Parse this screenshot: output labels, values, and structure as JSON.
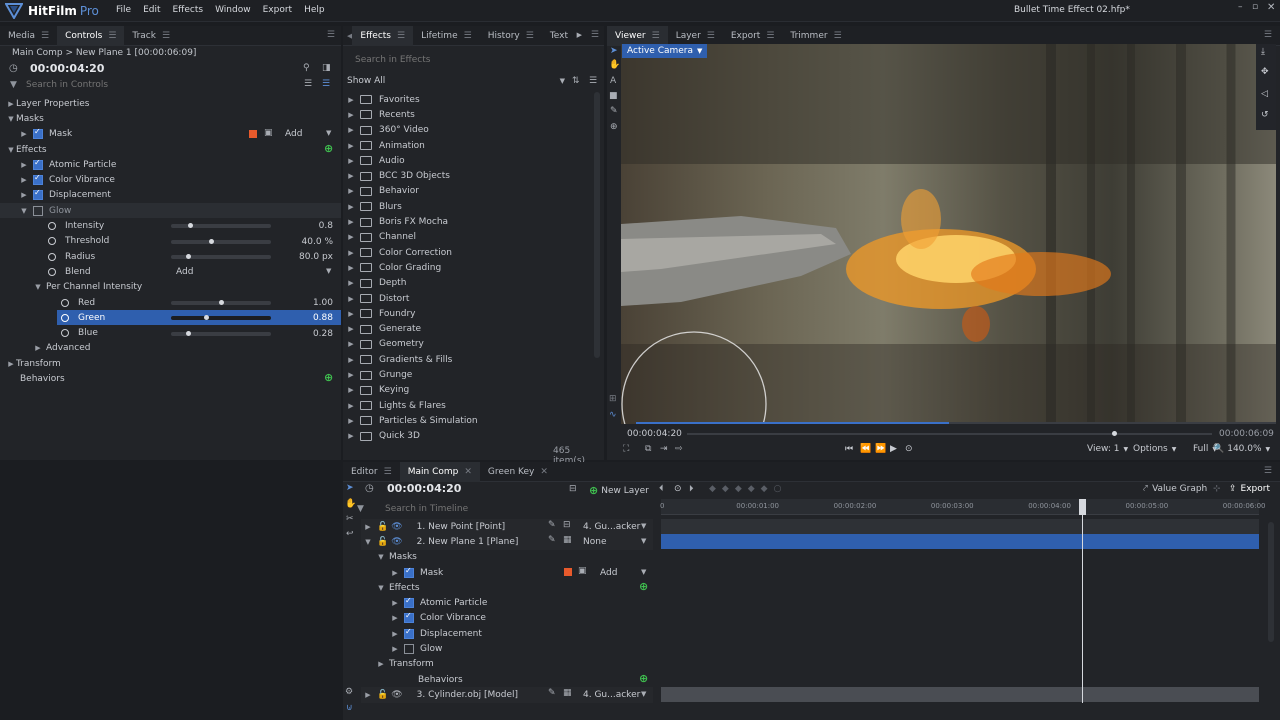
{
  "app": {
    "name": "HitFilm",
    "edition": "Pro",
    "window_title": "Bullet Time Effect 02.hfp*",
    "menu": [
      "File",
      "Edit",
      "Effects",
      "Window",
      "Export",
      "Help"
    ]
  },
  "controls": {
    "tabs": [
      "Media",
      "Controls",
      "Track"
    ],
    "breadcrumb": "Main Comp > New Plane 1 [00:00:06:09]",
    "timecode": "00:00:04:20",
    "search_placeholder": "Search in Controls",
    "layer_properties": "Layer Properties",
    "masks": "Masks",
    "mask": "Mask",
    "mask_blend": "Add",
    "effects": "Effects",
    "effect_items": [
      "Atomic Particle",
      "Color Vibrance",
      "Displacement",
      "Glow"
    ],
    "glow_params": [
      {
        "label": "Intensity",
        "value": "0.8",
        "level": 0.19
      },
      {
        "label": "Threshold",
        "value": "40.0 %",
        "level": 0.4
      },
      {
        "label": "Radius",
        "value": "80.0 px",
        "level": 0.17
      }
    ],
    "blend_label": "Blend",
    "blend_value": "Add",
    "per_channel": "Per Channel Intensity",
    "channels": [
      {
        "label": "Red",
        "value": "1.00",
        "level": 0.5
      },
      {
        "label": "Green",
        "value": "0.88",
        "level": 0.35
      },
      {
        "label": "Blue",
        "value": "0.28",
        "level": 0.17
      }
    ],
    "advanced": "Advanced",
    "transform": "Transform",
    "behaviors": "Behaviors"
  },
  "effects_panel": {
    "tabs": [
      "Effects",
      "Lifetime",
      "History",
      "Text"
    ],
    "search_placeholder": "Search in Effects",
    "filter": "Show All",
    "folders": [
      "Favorites",
      "Recents",
      "360° Video",
      "Animation",
      "Audio",
      "BCC 3D Objects",
      "Behavior",
      "Blurs",
      "Boris FX Mocha",
      "Channel",
      "Color Correction",
      "Color Grading",
      "Depth",
      "Distort",
      "Foundry",
      "Generate",
      "Geometry",
      "Gradients & Fills",
      "Grunge",
      "Keying",
      "Lights & Flares",
      "Particles & Simulation",
      "Quick 3D"
    ],
    "count": "465 item(s)"
  },
  "viewer": {
    "tabs": [
      "Viewer",
      "Layer",
      "Export",
      "Trimmer"
    ],
    "camera": "Active Camera",
    "time_current": "00:00:04:20",
    "time_end": "00:00:06:09",
    "progress": 0.58,
    "view": "View: 1",
    "options": "Options",
    "quality": "Full",
    "zoom": "140.0%"
  },
  "editor": {
    "tabs": [
      "Editor",
      "Main Comp",
      "Green Key"
    ],
    "timecode": "00:00:04:20",
    "new_layer": "New Layer",
    "search_placeholder": "Search in Timeline",
    "value_graph": "Value Graph",
    "export": "Export",
    "ruler": [
      "0",
      "00:00:01:00",
      "00:00:02:00",
      "00:00:03:00",
      "00:00:04:00",
      "00:00:05:00",
      "00:00:06:00"
    ],
    "layers": [
      {
        "name": "1. New Point [Point]",
        "parent": "4. Gu...acker"
      },
      {
        "name": "2. New Plane 1 [Plane]",
        "parent": "None"
      },
      {
        "name": "3. Cylinder.obj [Model]",
        "parent": "4. Gu...acker"
      }
    ],
    "sub": {
      "masks": "Masks",
      "mask": "Mask",
      "mask_blend": "Add",
      "effects": "Effects",
      "effect_items": [
        "Atomic Particle",
        "Color Vibrance",
        "Displacement",
        "Glow"
      ],
      "transform": "Transform",
      "behaviors": "Behaviors"
    }
  },
  "colors": {
    "accent": "#3a70c8",
    "selection": "#2f5fae",
    "mask_swatch": "#e85a2c",
    "plus": "#3fbf4f"
  }
}
